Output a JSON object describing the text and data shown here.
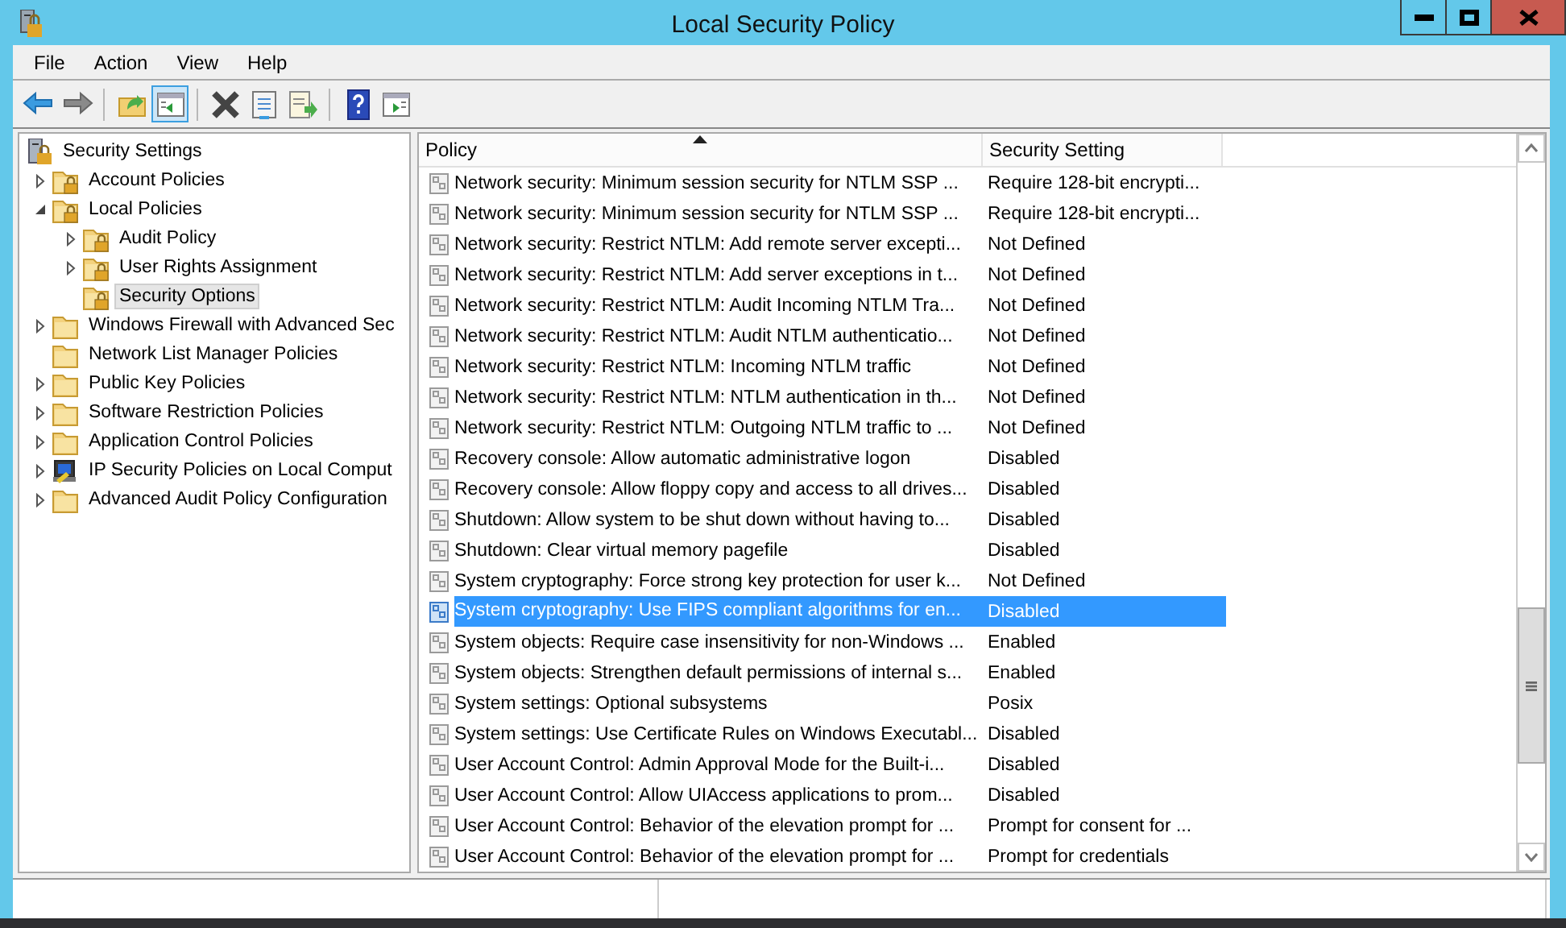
{
  "window": {
    "title": "Local Security Policy"
  },
  "menu": [
    "File",
    "Action",
    "View",
    "Help"
  ],
  "toolbar": [
    {
      "kind": "back",
      "pressed": false
    },
    {
      "kind": "forward",
      "pressed": false
    },
    {
      "kind": "separator"
    },
    {
      "kind": "up",
      "pressed": false
    },
    {
      "kind": "tree-toggle",
      "pressed": true
    },
    {
      "kind": "separator"
    },
    {
      "kind": "delete",
      "pressed": false
    },
    {
      "kind": "properties",
      "pressed": false
    },
    {
      "kind": "export",
      "pressed": false
    },
    {
      "kind": "separator"
    },
    {
      "kind": "help",
      "pressed": false
    },
    {
      "kind": "action-pane",
      "pressed": false
    }
  ],
  "tree": [
    {
      "label": "Security Settings",
      "kind": "server",
      "selected": false,
      "children": [
        {
          "label": "Account Policies",
          "kind": "folder-lock",
          "selected": false,
          "expanded": false
        },
        {
          "label": "Local Policies",
          "kind": "folder-lock",
          "selected": false,
          "expanded": true,
          "children": [
            {
              "label": "Audit Policy",
              "kind": "folder-lock",
              "selected": false,
              "expanded": false
            },
            {
              "label": "User Rights Assignment",
              "kind": "folder-lock",
              "selected": false,
              "expanded": false
            },
            {
              "label": "Security Options",
              "kind": "folder-lock",
              "selected": true
            }
          ]
        },
        {
          "label": "Windows Firewall with Advanced Sec",
          "kind": "folder",
          "selected": false,
          "expanded": false
        },
        {
          "label": "Network List Manager Policies",
          "kind": "folder",
          "selected": false
        },
        {
          "label": "Public Key Policies",
          "kind": "folder",
          "selected": false,
          "expanded": false
        },
        {
          "label": "Software Restriction Policies",
          "kind": "folder",
          "selected": false,
          "expanded": false
        },
        {
          "label": "Application Control Policies",
          "kind": "folder",
          "selected": false,
          "expanded": false
        },
        {
          "label": "IP Security Policies on Local Comput",
          "kind": "ip-security",
          "selected": false,
          "expanded": false
        },
        {
          "label": "Advanced Audit Policy Configuration",
          "kind": "folder",
          "selected": false,
          "expanded": false
        }
      ]
    }
  ],
  "table": {
    "columns": [
      "Policy",
      "Security Setting"
    ],
    "rows": [
      {
        "policy": "Network security: Minimum session security for NTLM SSP ...",
        "setting": "Require 128-bit encrypti...",
        "selected": false
      },
      {
        "policy": "Network security: Minimum session security for NTLM SSP ...",
        "setting": "Require 128-bit encrypti...",
        "selected": false
      },
      {
        "policy": "Network security: Restrict NTLM: Add remote server excepti...",
        "setting": "Not Defined",
        "selected": false
      },
      {
        "policy": "Network security: Restrict NTLM: Add server exceptions in t...",
        "setting": "Not Defined",
        "selected": false
      },
      {
        "policy": "Network security: Restrict NTLM: Audit Incoming NTLM Tra...",
        "setting": "Not Defined",
        "selected": false
      },
      {
        "policy": "Network security: Restrict NTLM: Audit NTLM authenticatio...",
        "setting": "Not Defined",
        "selected": false
      },
      {
        "policy": "Network security: Restrict NTLM: Incoming NTLM traffic",
        "setting": "Not Defined",
        "selected": false
      },
      {
        "policy": "Network security: Restrict NTLM: NTLM authentication in th...",
        "setting": "Not Defined",
        "selected": false
      },
      {
        "policy": "Network security: Restrict NTLM: Outgoing NTLM traffic to ...",
        "setting": "Not Defined",
        "selected": false
      },
      {
        "policy": "Recovery console: Allow automatic administrative logon",
        "setting": "Disabled",
        "selected": false
      },
      {
        "policy": "Recovery console: Allow floppy copy and access to all drives...",
        "setting": "Disabled",
        "selected": false
      },
      {
        "policy": "Shutdown: Allow system to be shut down without having to...",
        "setting": "Disabled",
        "selected": false
      },
      {
        "policy": "Shutdown: Clear virtual memory pagefile",
        "setting": "Disabled",
        "selected": false
      },
      {
        "policy": "System cryptography: Force strong key protection for user k...",
        "setting": "Not Defined",
        "selected": false
      },
      {
        "policy": "System cryptography: Use FIPS compliant algorithms for en...",
        "setting": "Disabled",
        "selected": true
      },
      {
        "policy": "System objects: Require case insensitivity for non-Windows ...",
        "setting": "Enabled",
        "selected": false
      },
      {
        "policy": "System objects: Strengthen default permissions of internal s...",
        "setting": "Enabled",
        "selected": false
      },
      {
        "policy": "System settings: Optional subsystems",
        "setting": "Posix",
        "selected": false
      },
      {
        "policy": "System settings: Use Certificate Rules on Windows Executabl...",
        "setting": "Disabled",
        "selected": false
      },
      {
        "policy": "User Account Control: Admin Approval Mode for the Built-i...",
        "setting": "Disabled",
        "selected": false
      },
      {
        "policy": "User Account Control: Allow UIAccess applications to prom...",
        "setting": "Disabled",
        "selected": false
      },
      {
        "policy": "User Account Control: Behavior of the elevation prompt for ...",
        "setting": "Prompt for consent for ...",
        "selected": false
      },
      {
        "policy": "User Account Control: Behavior of the elevation prompt for ...",
        "setting": "Prompt for credentials",
        "selected": false
      }
    ]
  }
}
